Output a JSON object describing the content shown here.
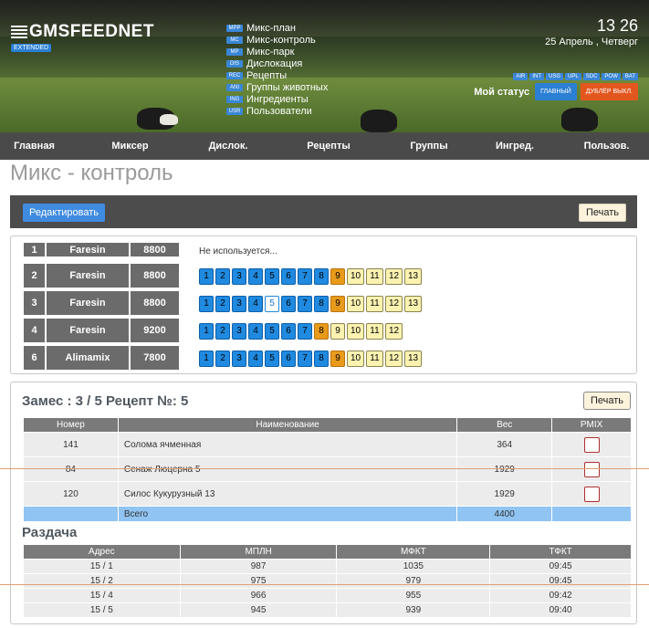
{
  "header": {
    "logo": "GMSFEEDNET",
    "edition_badge": "EXTENDED",
    "menu": [
      {
        "tag": "MPP",
        "label": "Микс-план"
      },
      {
        "tag": "MC",
        "label": "Микс-контроль"
      },
      {
        "tag": "MP",
        "label": "Микс-парк"
      },
      {
        "tag": "DIS",
        "label": "Дислокация"
      },
      {
        "tag": "REC",
        "label": "Рецепты"
      },
      {
        "tag": "ANI",
        "label": "Группы животных"
      },
      {
        "tag": "ING",
        "label": "Ингредиенты"
      },
      {
        "tag": "USR",
        "label": "Пользователи"
      }
    ],
    "time": "13 26",
    "date": "25 Апрель , Четверг",
    "mini_tags": [
      "AIR",
      "INT",
      "USG",
      "UPL",
      "SDC",
      "POW",
      "BAT"
    ],
    "status_label": "Мой статус",
    "status_main": "ГЛАВНЫЙ",
    "status_backup": "ДУБЛЁР ВЫКЛ."
  },
  "nav": [
    "Главная",
    "Миксер",
    "Дислок.",
    "Рецепты",
    "Группы",
    "Ингред.",
    "Пользов."
  ],
  "page_title": "Микс - контроль",
  "toolbar": {
    "edit": "Редактировать",
    "print": "Печать"
  },
  "mixers": {
    "unused_text": "Не используется...",
    "rows": [
      {
        "id": "1",
        "name": "Faresin",
        "cap": "8800"
      },
      {
        "id": "2",
        "name": "Faresin",
        "cap": "8800"
      },
      {
        "id": "3",
        "name": "Faresin",
        "cap": "8800"
      },
      {
        "id": "4",
        "name": "Faresin",
        "cap": "9200"
      },
      {
        "id": "6",
        "name": "Alimamix",
        "cap": "7800"
      }
    ],
    "steps": [
      "1",
      "2",
      "3",
      "4",
      "5",
      "6",
      "7",
      "8",
      "9",
      "10",
      "11",
      "12",
      "13"
    ]
  },
  "batch": {
    "title": "Замес : 3 / 5 Рецепт №: 5",
    "print": "Печать",
    "columns": [
      "Номер",
      "Наименование",
      "Вес",
      "PMIX"
    ],
    "rows": [
      {
        "num": "141",
        "name": "Солома ячменная",
        "weight": "364"
      },
      {
        "num": "84",
        "name": "Сенаж Люцерна 5",
        "weight": "1929"
      },
      {
        "num": "120",
        "name": "Силос Кукурузный 13",
        "weight": "1929"
      }
    ],
    "total_label": "Всего",
    "total_weight": "4400"
  },
  "razdacha": {
    "title": "Раздача",
    "columns": [
      "Адрес",
      "МПЛН",
      "МФКТ",
      "ТФКТ"
    ],
    "rows": [
      {
        "addr": "15 / 1",
        "plan": "987",
        "fact": "1035",
        "time": "09:45"
      },
      {
        "addr": "15 / 2",
        "plan": "975",
        "fact": "979",
        "time": "09:45"
      },
      {
        "addr": "15 / 4",
        "plan": "966",
        "fact": "955",
        "time": "09:42"
      },
      {
        "addr": "15 / 5",
        "plan": "945",
        "fact": "939",
        "time": "09:40"
      }
    ]
  },
  "colors": {
    "accent": "#2b7fd4",
    "nav_bg": "#4a4a4a",
    "orange": "#e89a1a",
    "alert": "#e3571f"
  }
}
